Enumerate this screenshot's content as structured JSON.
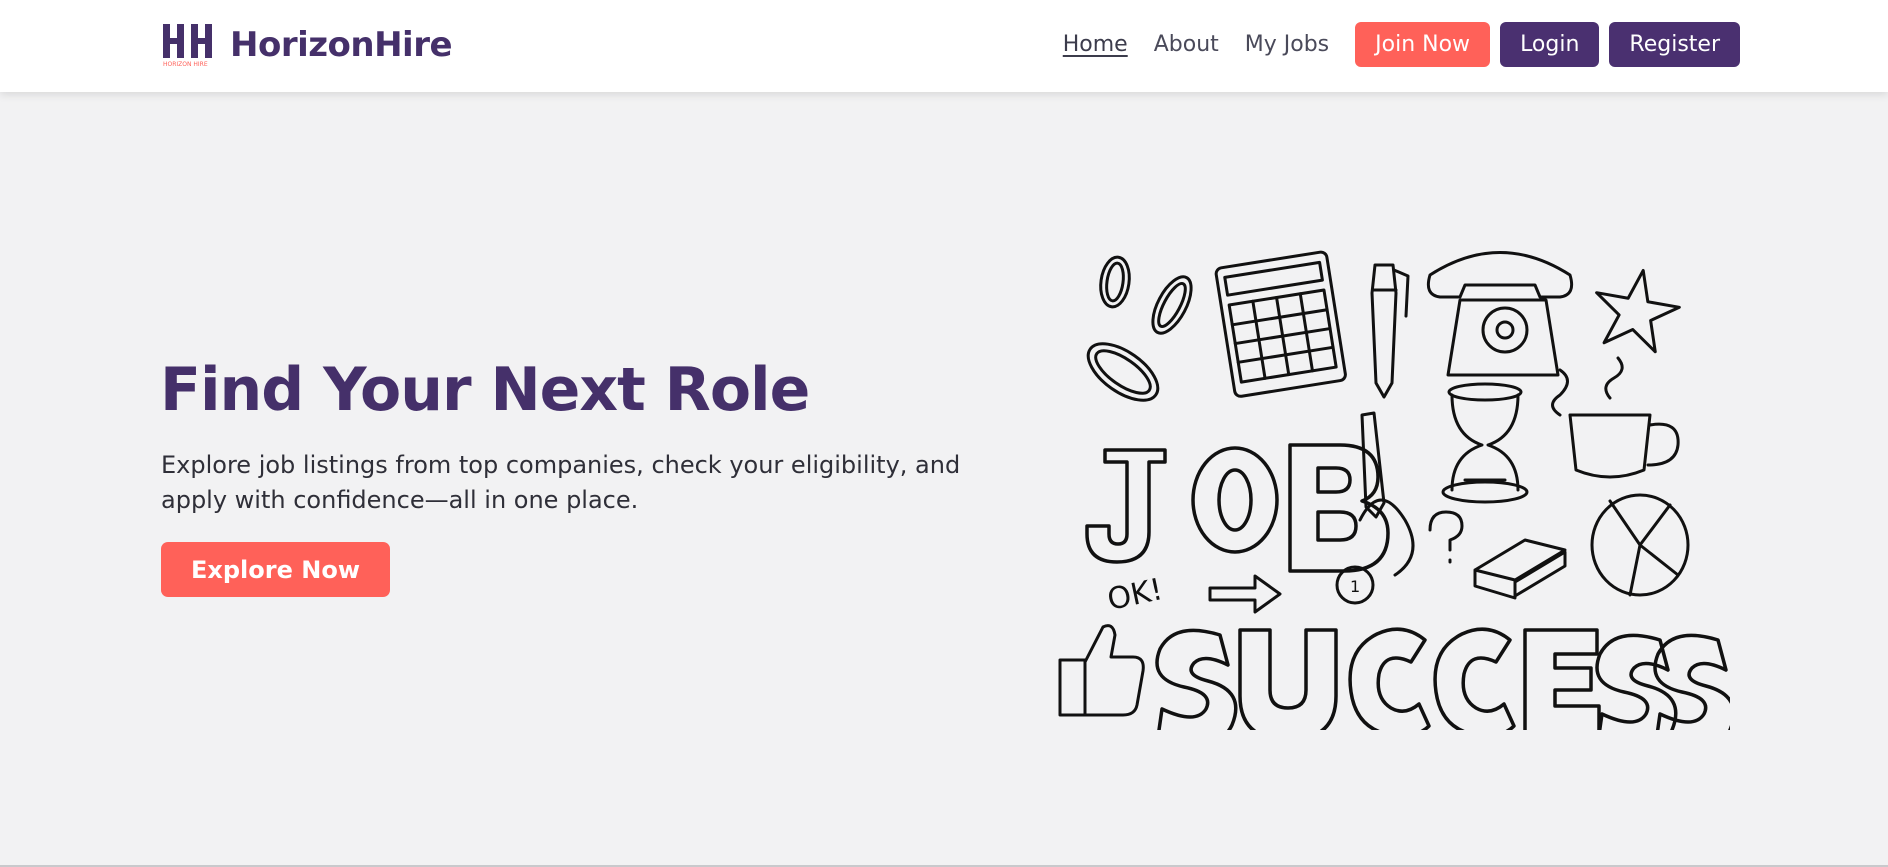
{
  "brand": {
    "name": "HorizonHire",
    "logo_caption": "HORIZON HIRE",
    "colors": {
      "primary": "#45306a",
      "accent": "#ff6159"
    }
  },
  "nav": {
    "links": [
      {
        "label": "Home",
        "active": true
      },
      {
        "label": "About",
        "active": false
      },
      {
        "label": "My Jobs",
        "active": false
      }
    ],
    "join_label": "Join Now",
    "login_label": "Login",
    "register_label": "Register"
  },
  "hero": {
    "title": "Find Your Next Role",
    "subtitle": "Explore job listings from top companies, check your eligibility, and apply with confidence—all in one place.",
    "cta_label": "Explore Now"
  },
  "illustration": {
    "word_top": "JOB",
    "word_bottom": "SUCCESS",
    "exclaim": "OK!",
    "medal_number": "1"
  }
}
